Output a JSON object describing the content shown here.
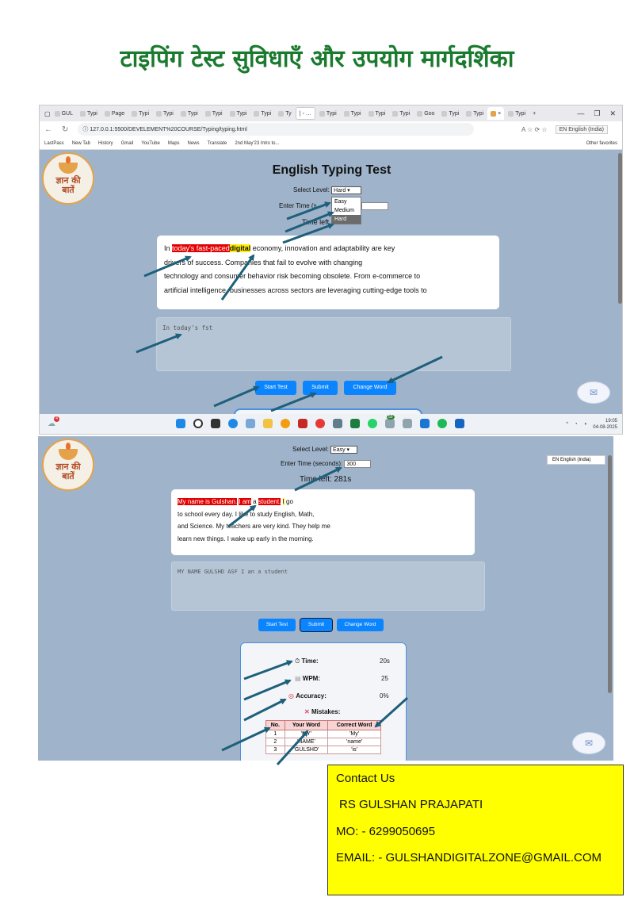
{
  "heading": "टाइपिंग टेस्ट सुविधाएँ और उपयोग मार्गदर्शिका",
  "browser": {
    "tabs": [
      "GUL",
      "Typi",
      "Page",
      "Typi",
      "Typi",
      "Typi",
      "Typi",
      "Typi",
      "Typi",
      "Ty",
      "Typi",
      "Typi",
      "Typi",
      "Typi",
      "Goo",
      "Typi",
      "Typi",
      "Typi"
    ],
    "new_tab": "+",
    "address": "127.0.0.1:5500/DEVELEMENT%20COURSE/Typing/typing.html",
    "language_pill": "EN English (India)",
    "bookmarks": [
      "LastPass",
      "New Tab",
      "History",
      "Gmail",
      "YouTube",
      "Maps",
      "News",
      "Translate",
      "2nd May'23 Intro to..."
    ],
    "other_favorites": "Other favorites"
  },
  "logo_text": [
    "ज्ञान की",
    "बातें"
  ],
  "screen1": {
    "title": "English Typing Test",
    "level_label": "Select Level:",
    "level_value": "Hard",
    "dropdown_options": [
      "Easy",
      "Medium",
      "Hard"
    ],
    "time_label": "Enter Time (s",
    "time_left": "Time left",
    "paragraph": {
      "prefix": "In ",
      "red": "today's fast-paced",
      "yellow": "digital",
      "rest1": " economy, innovation and adaptability are key",
      "line2": "drivers of success. Companies that fail to evolve with changing",
      "line3": "technology and consumer behavior risk becoming obsolete. From e-commerce to",
      "line4": "artificial intelligence, businesses across sectors are leveraging cutting-edge tools to"
    },
    "typed_text": "In today's fst",
    "buttons": [
      "Start Test",
      "Submit",
      "Change Word"
    ]
  },
  "taskbar": {
    "weather_badge": "4",
    "badge_count": "55",
    "time": "19:05",
    "date": "04-08-2025"
  },
  "screen2": {
    "level_label": "Select Level:",
    "level_value": "Easy",
    "time_label": "Enter Time (seconds):",
    "time_value": "300",
    "time_left": "Time left: 281s",
    "language_pill": "EN English (India)",
    "paragraph": {
      "red1": "My name is Gulshan.",
      "red2": "I am",
      "mid1": " a ",
      "red3": "student.",
      "yellow": "I",
      "rest1": " go",
      "line2": "to school every day. I like to study English, Math,",
      "line3": "and Science. My teachers are very kind. They help me",
      "line4": "learn new things. I wake up early in the morning."
    },
    "typed_text": "MY NAME GULSHD ASF I an a student",
    "buttons": [
      "Start Test",
      "Submit",
      "Change Word"
    ],
    "results": {
      "time_label": "Time:",
      "time_value": "20s",
      "wpm_label": "WPM:",
      "wpm_value": "25",
      "accuracy_label": "Accuracy:",
      "accuracy_value": "0%",
      "mistakes_label": "Mistakes:",
      "table_headers": [
        "No.",
        "Your Word",
        "Correct Word"
      ],
      "rows": [
        [
          "1",
          "'MY'",
          "'My'"
        ],
        [
          "2",
          "'NAME'",
          "'name'"
        ],
        [
          "3",
          "'GULSHD'",
          "'is'"
        ]
      ]
    }
  },
  "contact": {
    "title": "Contact Us",
    "name": "RS GULSHAN PRAJAPATI",
    "phone": "MO: - 6299050695",
    "email": "EMAIL: - GULSHANDIGITALZONE@GMAIL.COM"
  },
  "colors": {
    "heading": "#1a7a2e",
    "page_bg": "#9fb4cb",
    "button": "#0a84ff",
    "arrow": "#1e5f7a",
    "contact_bg": "#ffff00",
    "wrong_word": "#e30000",
    "current_word": "#ffee00"
  }
}
